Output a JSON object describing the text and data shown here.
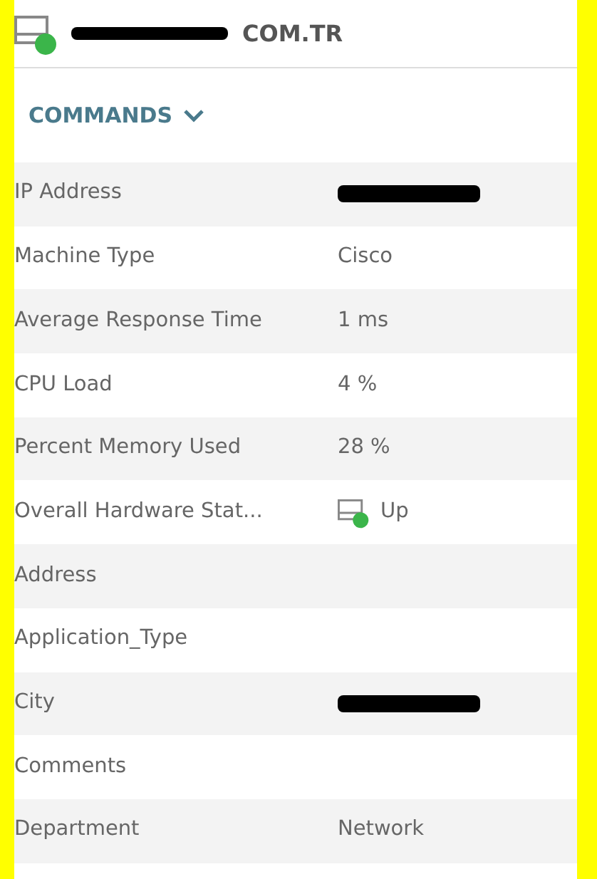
{
  "header": {
    "title": "COM.TR",
    "redacted": true
  },
  "commands": {
    "label": "COMMANDS",
    "expanded": false
  },
  "properties": [
    {
      "label": "IP Address",
      "kind": "redacted"
    },
    {
      "label": "Machine Type",
      "kind": "text",
      "value": "Cisco"
    },
    {
      "label": "Average Response Time",
      "kind": "text",
      "value": "1 ms"
    },
    {
      "label": "CPU Load",
      "kind": "text",
      "value": "4 %"
    },
    {
      "label": "Percent Memory Used",
      "kind": "text",
      "value": "28 %"
    },
    {
      "label": "Overall Hardware Stat...",
      "kind": "status",
      "value": "Up"
    },
    {
      "label": "Address",
      "kind": "text"
    },
    {
      "label": "Application_Type",
      "kind": "text"
    },
    {
      "label": "City",
      "kind": "redacted"
    },
    {
      "label": "Comments",
      "kind": "text"
    },
    {
      "label": "Department",
      "kind": "text",
      "value": "Network"
    }
  ]
}
